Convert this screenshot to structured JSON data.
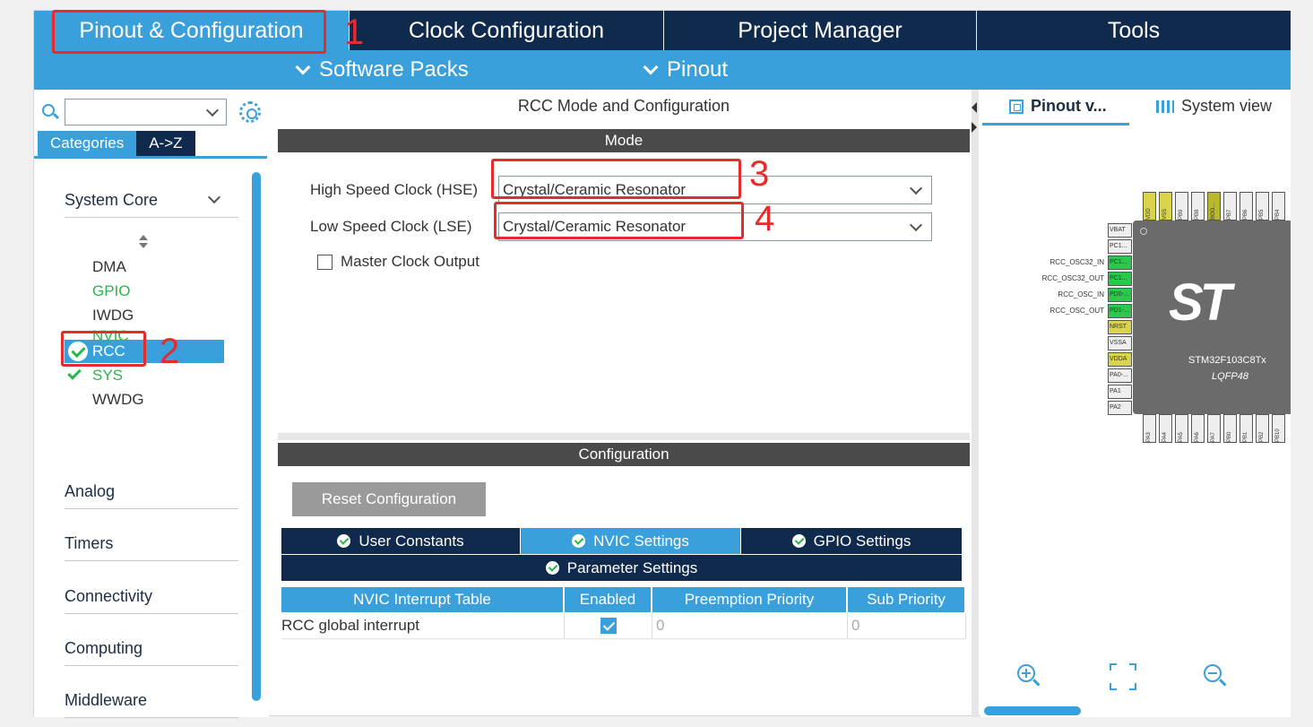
{
  "top_tabs": [
    "Pinout & Configuration",
    "Clock Configuration",
    "Project Manager",
    "Tools"
  ],
  "sub_menu": [
    "Software Packs",
    "Pinout"
  ],
  "left_panel": {
    "search": {
      "value": ""
    },
    "tabs": [
      "Categories",
      "A->Z"
    ],
    "categories": {
      "system_core": "System Core",
      "analog": "Analog",
      "timers": "Timers",
      "connectivity": "Connectivity",
      "computing": "Computing",
      "middleware": "Middleware"
    },
    "system_core_items": [
      "DMA",
      "GPIO",
      "IWDG",
      "NVIC",
      "RCC",
      "SYS",
      "WWDG"
    ]
  },
  "mode_panel": {
    "title": "RCC Mode and Configuration",
    "mode_header": "Mode",
    "hse_label": "High Speed Clock (HSE)",
    "hse_value": "Crystal/Ceramic Resonator",
    "lse_label": "Low Speed Clock (LSE)",
    "lse_value": "Crystal/Ceramic Resonator",
    "mco_label": "Master Clock Output",
    "config_header": "Configuration",
    "reset_button": "Reset Configuration",
    "config_tabs": [
      "User Constants",
      "NVIC Settings",
      "GPIO Settings",
      "Parameter Settings"
    ],
    "nvic_table": {
      "headers": [
        "NVIC Interrupt Table",
        "Enabled",
        "Preemption Priority",
        "Sub Priority"
      ],
      "rows": [
        {
          "name": "RCC global interrupt",
          "enabled": true,
          "preemption": "0",
          "sub": "0"
        }
      ]
    }
  },
  "right_panel": {
    "view_tabs": [
      "Pinout v...",
      "System view"
    ],
    "chip_name": "STM32F103C8Tx",
    "chip_package": "LQFP48",
    "left_pins": [
      "VBAT",
      "PC1...",
      "PC1...",
      "PC1...",
      "PD0-...",
      "PD1-...",
      "NRST",
      "VSSA",
      "VDDA",
      "PA0-...",
      "PA1",
      "PA2"
    ],
    "signal_labels": [
      "RCC_OSC32_IN",
      "RCC_OSC32_OUT",
      "RCC_OSC_IN",
      "RCC_OSC_OUT"
    ],
    "top_pins": [
      "VDD",
      "VSS",
      "PB9",
      "PB8",
      "BOO...",
      "PB7",
      "PB6",
      "PB5",
      "PB4"
    ],
    "bottom_pins": [
      "PA3",
      "PA4",
      "PA5",
      "PA6",
      "PA7",
      "PB0",
      "PB1",
      "PB2",
      "PB10"
    ]
  },
  "annotations": [
    "1",
    "2",
    "3",
    "4"
  ],
  "colors": {
    "navy": "#0f2a4d",
    "accent": "#3aa0dc",
    "green": "#2bb54a",
    "highlight": "#e52b2b"
  }
}
